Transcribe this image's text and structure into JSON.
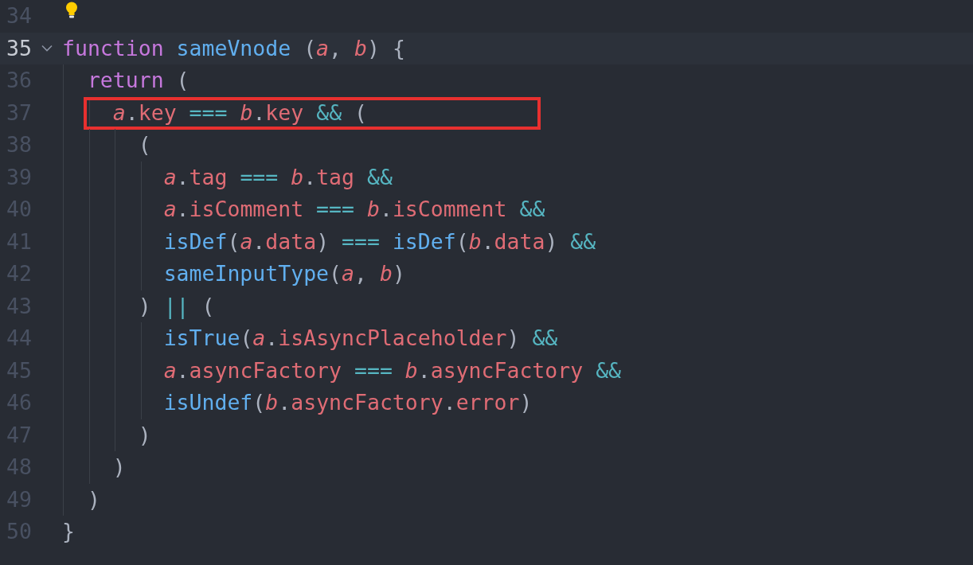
{
  "editor": {
    "lines": [
      {
        "number": "34",
        "current": false,
        "boxed": false,
        "lightbulb": true
      },
      {
        "number": "35",
        "current": true,
        "boxed": false,
        "foldable": true,
        "tokens": [
          {
            "kind": "kw",
            "text": "function "
          },
          {
            "kind": "fn",
            "text": "sameVnode"
          },
          {
            "kind": "punct",
            "text": " ("
          },
          {
            "kind": "param",
            "text": "a"
          },
          {
            "kind": "punct",
            "text": ", "
          },
          {
            "kind": "param",
            "text": "b"
          },
          {
            "kind": "punct",
            "text": ") {"
          }
        ]
      },
      {
        "number": "36",
        "current": false,
        "boxed": false,
        "tokens": [
          {
            "kind": "kw",
            "text": "  return"
          },
          {
            "kind": "punct",
            "text": " ("
          }
        ]
      },
      {
        "number": "37",
        "current": false,
        "boxed": true,
        "tokens": [
          {
            "kind": "param",
            "text": "    a"
          },
          {
            "kind": "punct",
            "text": "."
          },
          {
            "kind": "prop",
            "text": "key"
          },
          {
            "kind": "op",
            "text": " === "
          },
          {
            "kind": "param",
            "text": "b"
          },
          {
            "kind": "punct",
            "text": "."
          },
          {
            "kind": "prop",
            "text": "key"
          },
          {
            "kind": "op",
            "text": " && "
          },
          {
            "kind": "punct",
            "text": "("
          }
        ]
      },
      {
        "number": "38",
        "current": false,
        "boxed": false,
        "tokens": [
          {
            "kind": "punct",
            "text": "      ("
          }
        ]
      },
      {
        "number": "39",
        "current": false,
        "boxed": false,
        "tokens": [
          {
            "kind": "param",
            "text": "        a"
          },
          {
            "kind": "punct",
            "text": "."
          },
          {
            "kind": "prop",
            "text": "tag"
          },
          {
            "kind": "op",
            "text": " === "
          },
          {
            "kind": "param",
            "text": "b"
          },
          {
            "kind": "punct",
            "text": "."
          },
          {
            "kind": "prop",
            "text": "tag"
          },
          {
            "kind": "op",
            "text": " &&"
          }
        ]
      },
      {
        "number": "40",
        "current": false,
        "boxed": false,
        "tokens": [
          {
            "kind": "param",
            "text": "        a"
          },
          {
            "kind": "punct",
            "text": "."
          },
          {
            "kind": "prop",
            "text": "isComment"
          },
          {
            "kind": "op",
            "text": " === "
          },
          {
            "kind": "param",
            "text": "b"
          },
          {
            "kind": "punct",
            "text": "."
          },
          {
            "kind": "prop",
            "text": "isComment"
          },
          {
            "kind": "op",
            "text": " &&"
          }
        ]
      },
      {
        "number": "41",
        "current": false,
        "boxed": false,
        "tokens": [
          {
            "kind": "fn",
            "text": "        isDef"
          },
          {
            "kind": "punct",
            "text": "("
          },
          {
            "kind": "param",
            "text": "a"
          },
          {
            "kind": "punct",
            "text": "."
          },
          {
            "kind": "prop",
            "text": "data"
          },
          {
            "kind": "punct",
            "text": ")"
          },
          {
            "kind": "op",
            "text": " === "
          },
          {
            "kind": "fn",
            "text": "isDef"
          },
          {
            "kind": "punct",
            "text": "("
          },
          {
            "kind": "param",
            "text": "b"
          },
          {
            "kind": "punct",
            "text": "."
          },
          {
            "kind": "prop",
            "text": "data"
          },
          {
            "kind": "punct",
            "text": ")"
          },
          {
            "kind": "op",
            "text": " &&"
          }
        ]
      },
      {
        "number": "42",
        "current": false,
        "boxed": false,
        "tokens": [
          {
            "kind": "fn",
            "text": "        sameInputType"
          },
          {
            "kind": "punct",
            "text": "("
          },
          {
            "kind": "param",
            "text": "a"
          },
          {
            "kind": "punct",
            "text": ", "
          },
          {
            "kind": "param",
            "text": "b"
          },
          {
            "kind": "punct",
            "text": ")"
          }
        ]
      },
      {
        "number": "43",
        "current": false,
        "boxed": false,
        "tokens": [
          {
            "kind": "punct",
            "text": "      )"
          },
          {
            "kind": "op",
            "text": " || "
          },
          {
            "kind": "punct",
            "text": "("
          }
        ]
      },
      {
        "number": "44",
        "current": false,
        "boxed": false,
        "tokens": [
          {
            "kind": "fn",
            "text": "        isTrue"
          },
          {
            "kind": "punct",
            "text": "("
          },
          {
            "kind": "param",
            "text": "a"
          },
          {
            "kind": "punct",
            "text": "."
          },
          {
            "kind": "prop",
            "text": "isAsyncPlaceholder"
          },
          {
            "kind": "punct",
            "text": ")"
          },
          {
            "kind": "op",
            "text": " &&"
          }
        ]
      },
      {
        "number": "45",
        "current": false,
        "boxed": false,
        "tokens": [
          {
            "kind": "param",
            "text": "        a"
          },
          {
            "kind": "punct",
            "text": "."
          },
          {
            "kind": "prop",
            "text": "asyncFactory"
          },
          {
            "kind": "op",
            "text": " === "
          },
          {
            "kind": "param",
            "text": "b"
          },
          {
            "kind": "punct",
            "text": "."
          },
          {
            "kind": "prop",
            "text": "asyncFactory"
          },
          {
            "kind": "op",
            "text": " &&"
          }
        ]
      },
      {
        "number": "46",
        "current": false,
        "boxed": false,
        "tokens": [
          {
            "kind": "fn",
            "text": "        isUndef"
          },
          {
            "kind": "punct",
            "text": "("
          },
          {
            "kind": "param",
            "text": "b"
          },
          {
            "kind": "punct",
            "text": "."
          },
          {
            "kind": "prop",
            "text": "asyncFactory"
          },
          {
            "kind": "punct",
            "text": "."
          },
          {
            "kind": "prop",
            "text": "error"
          },
          {
            "kind": "punct",
            "text": ")"
          }
        ]
      },
      {
        "number": "47",
        "current": false,
        "boxed": false,
        "tokens": [
          {
            "kind": "punct",
            "text": "      )"
          }
        ]
      },
      {
        "number": "48",
        "current": false,
        "boxed": false,
        "tokens": [
          {
            "kind": "punct",
            "text": "    )"
          }
        ]
      },
      {
        "number": "49",
        "current": false,
        "boxed": false,
        "tokens": [
          {
            "kind": "punct",
            "text": "  )"
          }
        ]
      },
      {
        "number": "50",
        "current": false,
        "boxed": false,
        "tokens": [
          {
            "kind": "punct",
            "text": "}"
          }
        ]
      }
    ]
  }
}
